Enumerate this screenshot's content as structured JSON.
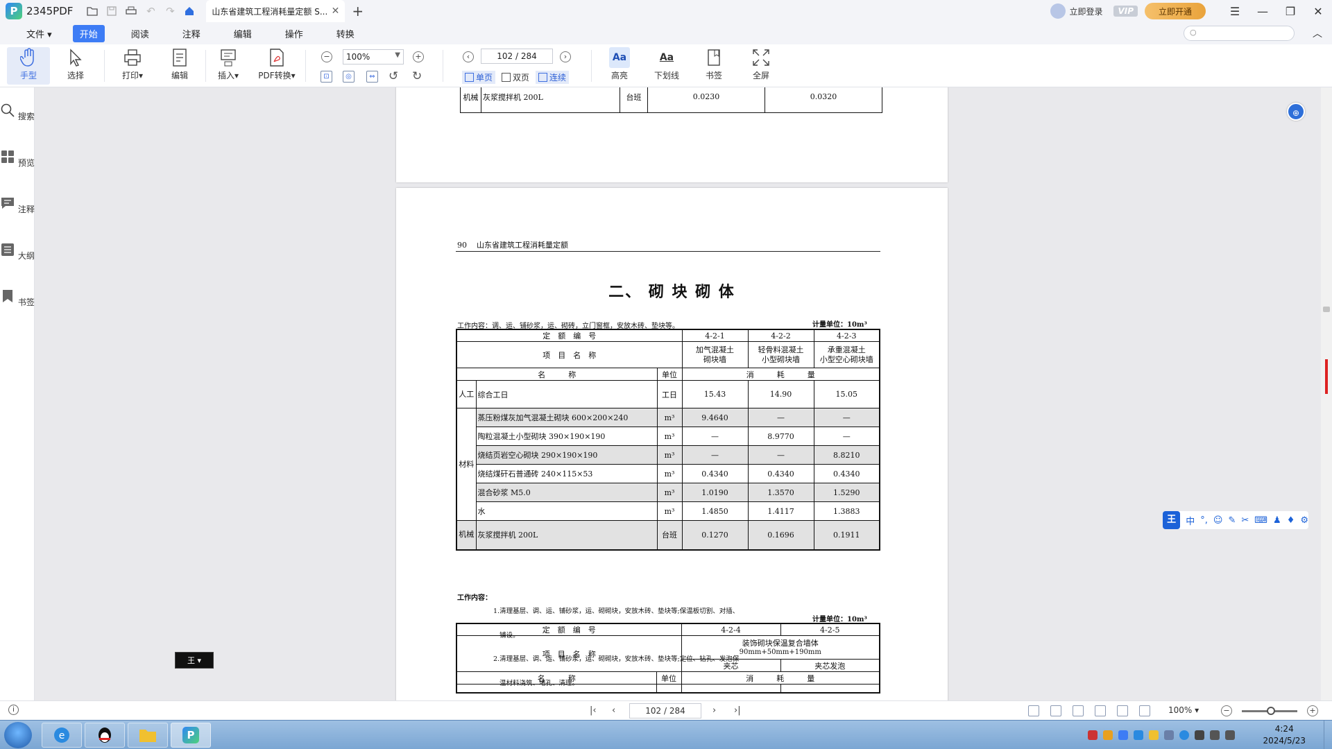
{
  "app": {
    "name": "2345PDF",
    "tab_title": "山东省建筑工程消耗量定额 S...",
    "login": "立即登录",
    "vip": "VIP",
    "open_vip": "立即开通"
  },
  "menu": [
    "文件",
    "开始",
    "阅读",
    "注释",
    "编辑",
    "操作",
    "转换"
  ],
  "menu_active": "开始",
  "toolbar": {
    "hand": "手型",
    "select": "选择",
    "print": "打印",
    "edit": "编辑",
    "insert": "插入",
    "pdf_convert": "PDF转换",
    "zoom": "100%",
    "page": "102 / 284",
    "single": "单页",
    "double": "双页",
    "continuous": "连续",
    "highlight": "高亮",
    "underline": "下划线",
    "bookmark": "书签",
    "fullscreen": "全屏"
  },
  "sidebar": [
    "搜索",
    "预览",
    "注释",
    "大纲",
    "书签"
  ],
  "prev_page": {
    "row_group": "机械",
    "row_name": "灰浆搅拌机 200L",
    "unit": "台班",
    "v1": "0.0230",
    "v2": "0.0320"
  },
  "page": {
    "page_number": "90",
    "running_head": "山东省建筑工程消耗量定额",
    "section_title": "二、 砌 块 砌 体",
    "work1": "工作内容：调、运、铺砂浆，运、砌砖，立门窗框，安放木砖、垫块等。",
    "unit_label": "计量单位：10m³",
    "t1": {
      "code_label": "定　额　编　号",
      "codes": [
        "4-2-1",
        "4-2-2",
        "4-2-3"
      ],
      "item_label": "项　目　名　称",
      "items": [
        "加气混凝土\n砌块墙",
        "轻骨料混凝土\n小型砌块墙",
        "承重混凝土\n小型空心砌块墙"
      ],
      "name_label": "名　　　称",
      "unit_col": "单位",
      "consume_label": "消　　　耗　　　量",
      "labor_group": "人工",
      "labor": {
        "name": "综合工日",
        "unit": "工日",
        "v": [
          "15.43",
          "14.90",
          "15.05"
        ]
      },
      "material_group": "材料",
      "materials": [
        {
          "name": "蒸压粉煤灰加气混凝土砌块 600×200×240",
          "unit": "m³",
          "v": [
            "9.4640",
            "—",
            "—"
          ]
        },
        {
          "name": "陶粒混凝土小型砌块 390×190×190",
          "unit": "m³",
          "v": [
            "—",
            "8.9770",
            "—"
          ]
        },
        {
          "name": "烧结页岩空心砌块 290×190×190",
          "unit": "m³",
          "v": [
            "—",
            "—",
            "8.8210"
          ]
        },
        {
          "name": "烧结煤矸石普通砖 240×115×53",
          "unit": "m³",
          "v": [
            "0.4340",
            "0.4340",
            "0.4340"
          ]
        },
        {
          "name": "混合砂浆 M5.0",
          "unit": "m³",
          "v": [
            "1.0190",
            "1.3570",
            "1.5290"
          ]
        },
        {
          "name": "水",
          "unit": "m³",
          "v": [
            "1.4850",
            "1.4117",
            "1.3883"
          ]
        }
      ],
      "machine_group": "机械",
      "machine": {
        "name": "灰浆搅拌机 200L",
        "unit": "台班",
        "v": [
          "0.1270",
          "0.1696",
          "0.1911"
        ]
      }
    },
    "work2_label": "工作内容：",
    "work2_lines": [
      "1.清理基层、调、运、铺砂浆，运、砌砌块，安放木砖、垫块等;保温板切割、对插、",
      "   铺设。",
      "2.清理基层、调、运、铺砂浆，运、砌砌块，安放木砖、垫块等;定位、钻孔、发泡保",
      "   温材料浇筑、堵孔、清理。"
    ],
    "t2": {
      "code_label": "定　额　编　号",
      "codes": [
        "4-2-4",
        "4-2-5"
      ],
      "item_label": "项　目　名　称",
      "header": "装饰砌块保温复合墙体",
      "subheader": "90mm+50mm+190mm",
      "subitems": [
        "夹芯",
        "夹芯发泡"
      ],
      "name_label": "名　　　称",
      "unit_col": "单位",
      "consume_label": "消　　　耗　　　量"
    }
  },
  "status": {
    "page": "102 / 284",
    "zoom": "100%"
  },
  "clock": {
    "time": "4:24",
    "date": "2024/5/23"
  },
  "ime": {
    "logo": "王",
    "mode": "中"
  },
  "colors": {
    "accent": "#3d7cf5",
    "vip": "#e9a33c",
    "taskbar": "#8fb4dc"
  }
}
